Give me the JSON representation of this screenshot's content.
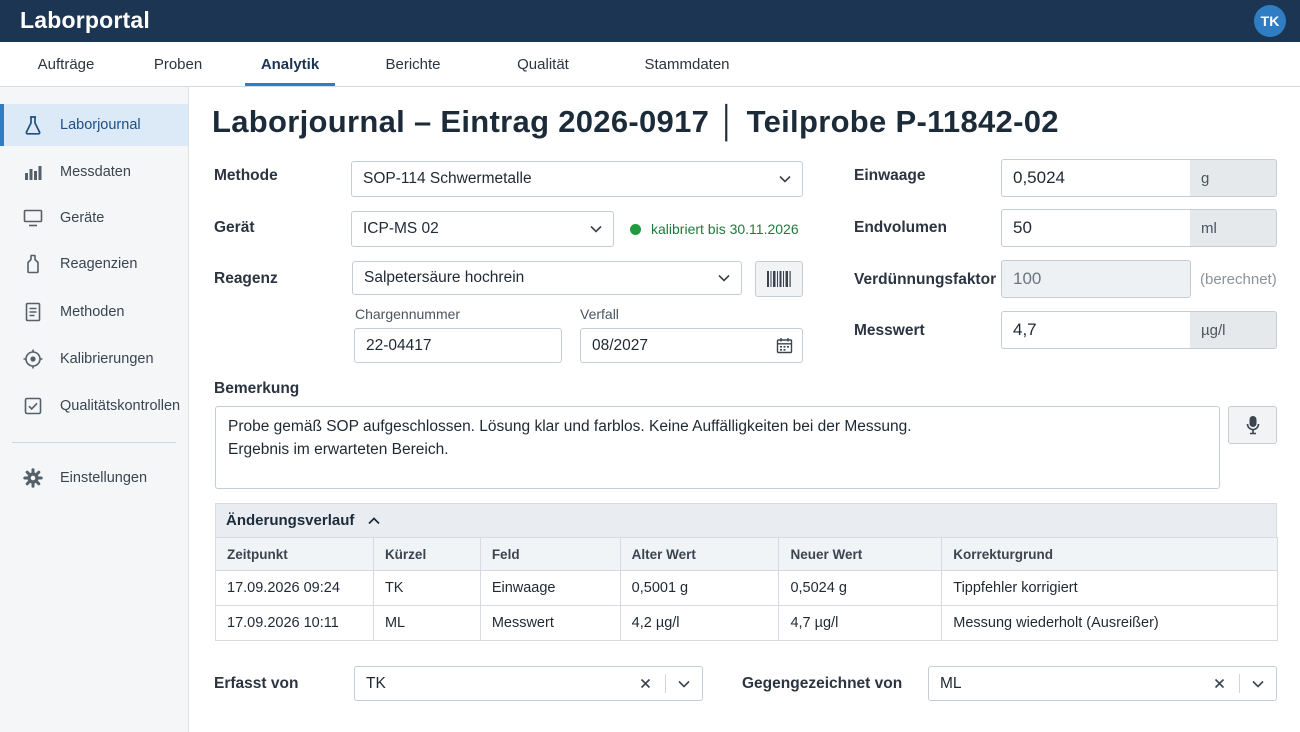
{
  "app": {
    "title": "Laborportal",
    "user_initials": "TK"
  },
  "tabs": [
    {
      "label": "Aufträge"
    },
    {
      "label": "Proben"
    },
    {
      "label": "Analytik"
    },
    {
      "label": "Berichte"
    },
    {
      "label": "Qualität"
    },
    {
      "label": "Stammdaten"
    }
  ],
  "sidebar": {
    "items": [
      {
        "label": "Laborjournal",
        "icon": "flask-icon"
      },
      {
        "label": "Messdaten",
        "icon": "bar-chart-icon"
      },
      {
        "label": "Geräte",
        "icon": "monitor-icon"
      },
      {
        "label": "Reagenzien",
        "icon": "bottle-icon"
      },
      {
        "label": "Methoden",
        "icon": "document-icon"
      },
      {
        "label": "Kalibrierungen",
        "icon": "target-icon"
      },
      {
        "label": "Qualitätskontrollen",
        "icon": "checkbox-icon"
      }
    ],
    "settings_label": "Einstellungen"
  },
  "page": {
    "title": "Laborjournal – Eintrag 2026-0917 │ Teilprobe P-11842-02"
  },
  "form": {
    "methode_label": "Methode",
    "methode_value": "SOP-114  Schwermetalle",
    "geraet_label": "Gerät",
    "geraet_value": "ICP-MS 02",
    "geraet_status": "kalibriert bis 30.11.2026",
    "reagenz_label": "Reagenz",
    "reagenz_value": "Salpetersäure hochrein",
    "charge_label": "Chargennummer",
    "charge_value": "22-04417",
    "verfall_label": "Verfall",
    "verfall_value": "08/2027",
    "einwaage_label": "Einwaage",
    "einwaage_value": "0,5024",
    "einwaage_unit": "g",
    "endvolumen_label": "Endvolumen",
    "endvolumen_value": "50",
    "endvolumen_unit": "ml",
    "verduennung_label": "Verdünnungsfaktor",
    "verduennung_value": "100",
    "verduennung_hint": "(berechnet)",
    "messwert_label": "Messwert",
    "messwert_value": "4,7",
    "messwert_unit": "µg/l",
    "bemerkung_label": "Bemerkung",
    "bemerkung_line1": "Probe gemäß SOP aufgeschlossen. Lösung klar und farblos. Keine Auffälligkeiten bei der Messung.",
    "bemerkung_line2": "Ergebnis im erwarteten Bereich."
  },
  "history": {
    "title": "Änderungsverlauf",
    "columns": [
      "Zeitpunkt",
      "Kürzel",
      "Feld",
      "Alter Wert",
      "Neuer Wert",
      "Korrekturgrund"
    ],
    "rows": [
      [
        "17.09.2026 09:24",
        "TK",
        "Einwaage",
        "0,5001 g",
        "0,5024 g",
        "Tippfehler korrigiert"
      ],
      [
        "17.09.2026 10:11",
        "ML",
        "Messwert",
        "4,2 µg/l",
        "4,7 µg/l",
        "Messung wiederholt (Ausreißer)"
      ]
    ]
  },
  "footer": {
    "erfasst_label": "Erfasst von",
    "erfasst_value": "TK",
    "gegengezeichnet_label": "Gegengezeichnet von",
    "gegengezeichnet_value": "ML"
  },
  "colors": {
    "topbar": "#1c3552",
    "accent": "#2f7dc3",
    "status_ok": "#1f9a3e"
  }
}
